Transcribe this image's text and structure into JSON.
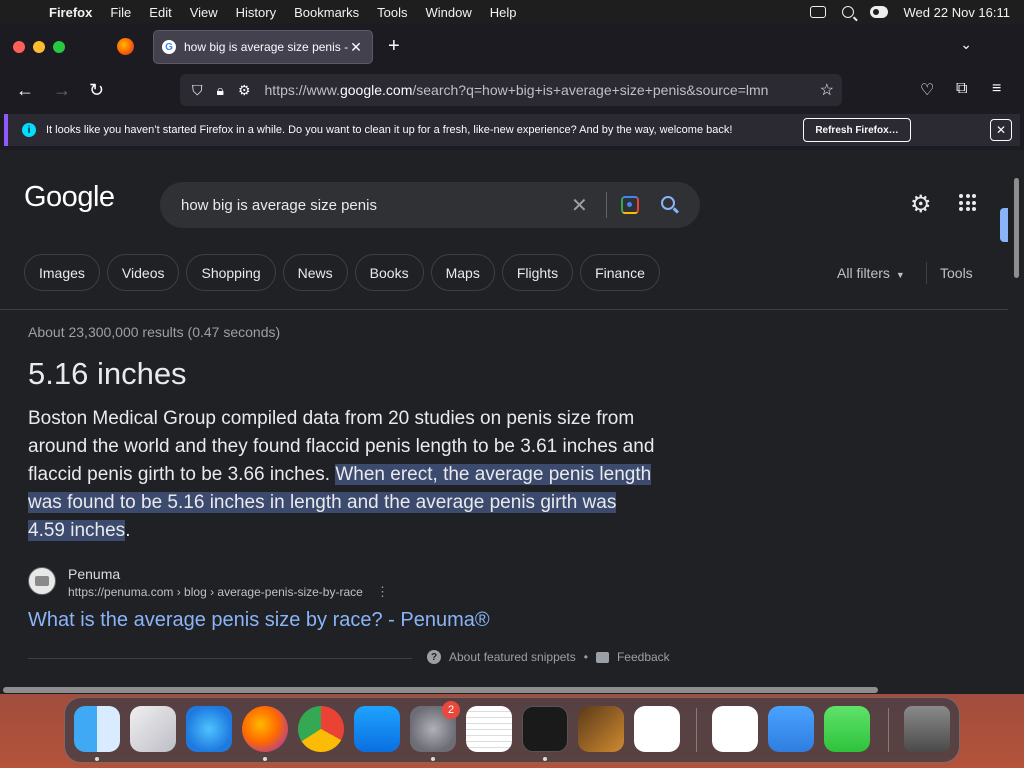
{
  "menubar": {
    "apple": "",
    "app": "Firefox",
    "items": [
      "File",
      "Edit",
      "View",
      "History",
      "Bookmarks",
      "Tools",
      "Window",
      "Help"
    ],
    "datetime": "Wed 22 Nov  16:11"
  },
  "browser": {
    "tab_title": "how big is average size penis - G",
    "url_prefix": "https://www.",
    "url_domain": "google.com",
    "url_rest": "/search?q=how+big+is+average+size+penis&source=lmn",
    "notification": "It looks like you haven’t started Firefox in a while. Do you want to clean it up for a fresh, like-new experience? And by the way, welcome back!",
    "refresh_label": "Refresh Firefox…"
  },
  "google": {
    "logo": "Google",
    "query": "how big is average size penis",
    "chips": [
      "Images",
      "Videos",
      "Shopping",
      "News",
      "Books",
      "Maps",
      "Flights",
      "Finance"
    ],
    "all_filters": "All filters",
    "tools": "Tools",
    "stats": "About 23,300,000 results (0.47 seconds)",
    "answer": "5.16 inches",
    "snippet_plain": "Boston Medical Group compiled data from 20 studies on penis size from around the world and they found flaccid penis length to be 3.61 inches and flaccid penis girth to be 3.66 inches. ",
    "snippet_highlight": "When erect, the average penis length was found to be 5.16 inches in length and the average penis girth was 4.59 inches",
    "snippet_end": ".",
    "source_name": "Penuma",
    "source_url": "https://penuma.com › blog › average-penis-size-by-race",
    "result_title": "What is the average penis size by race? - Penuma®",
    "about_snippets": "About featured snippets",
    "feedback": "Feedback"
  },
  "dock": {
    "apps": [
      "Finder",
      "Launchpad",
      "Safari",
      "Firefox",
      "Chrome",
      "App Store",
      "System Settings",
      "TextEdit",
      "Terminal",
      "GarageBand",
      "Visual Studio Code",
      "Visual Studio",
      "Weather",
      "Messages",
      "Trash"
    ],
    "settings_badge": "2"
  },
  "colors": {
    "google_bg": "#202124",
    "link": "#8ab4f8",
    "highlight": "#3c4a6e",
    "firefox_chrome": "#1c1b22"
  }
}
